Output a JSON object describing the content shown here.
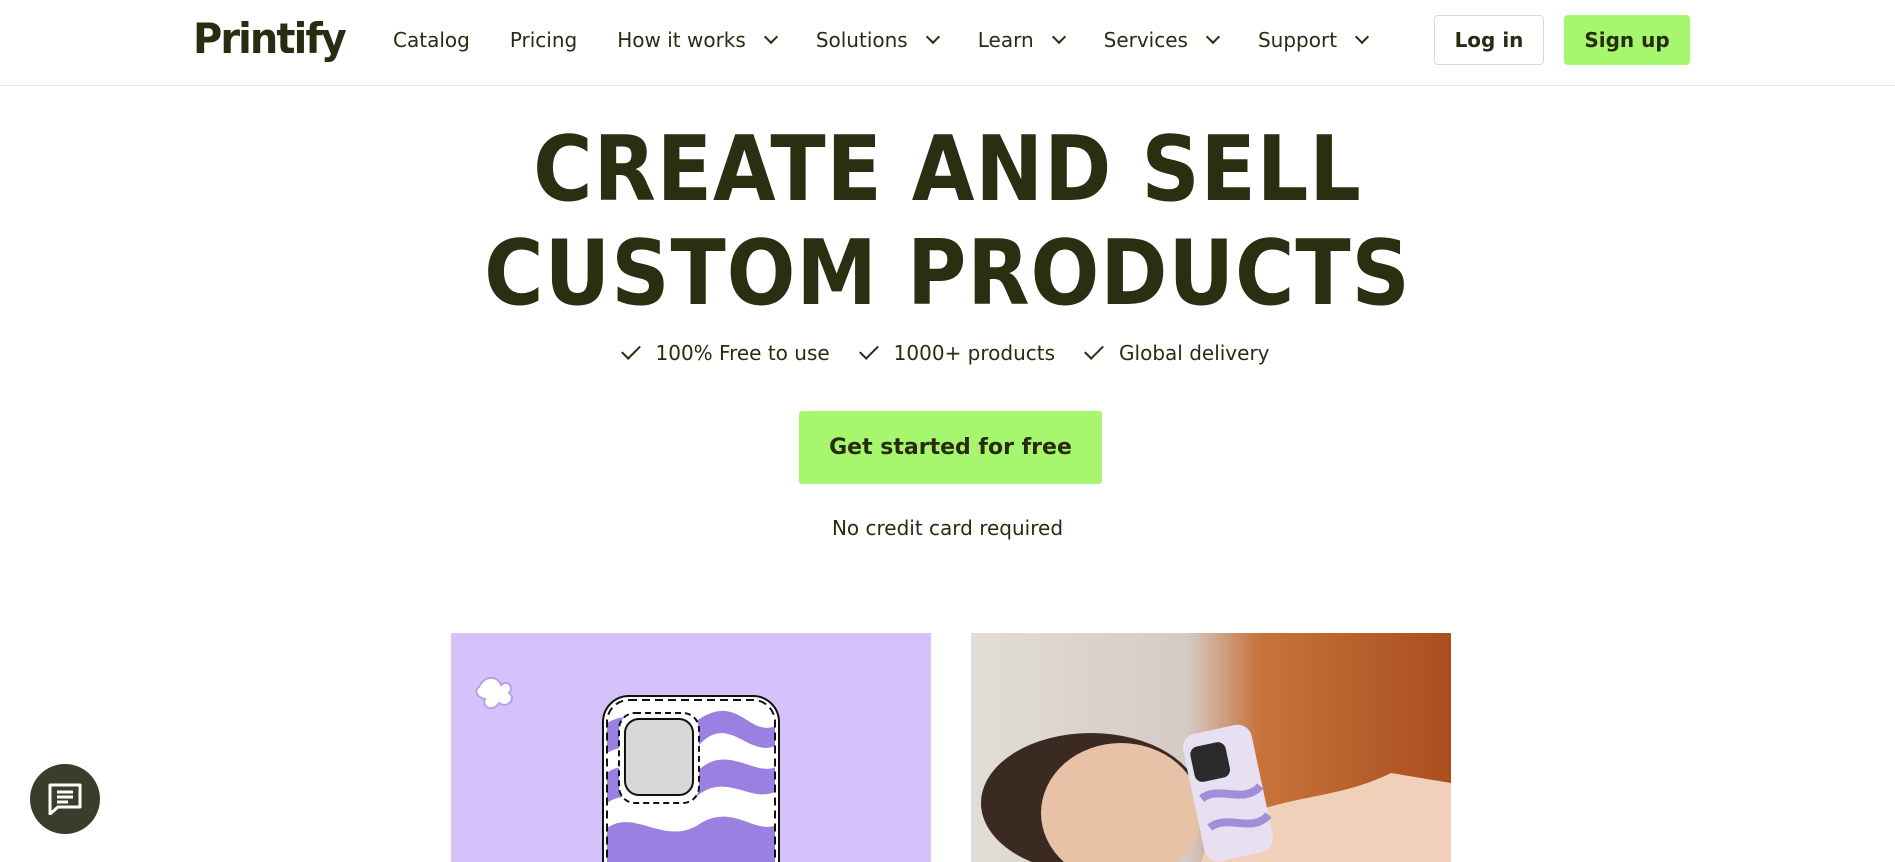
{
  "header": {
    "logo": "Printify",
    "nav": [
      {
        "label": "Catalog",
        "has_dropdown": false
      },
      {
        "label": "Pricing",
        "has_dropdown": false
      },
      {
        "label": "How it works",
        "has_dropdown": true
      },
      {
        "label": "Solutions",
        "has_dropdown": true
      },
      {
        "label": "Learn",
        "has_dropdown": true
      },
      {
        "label": "Services",
        "has_dropdown": true
      },
      {
        "label": "Support",
        "has_dropdown": true
      }
    ],
    "login_label": "Log in",
    "signup_label": "Sign up"
  },
  "hero": {
    "title_line1": "CREATE AND SELL",
    "title_line2": "CUSTOM PRODUCTS",
    "perks": [
      "100% Free to use",
      "1000+ products",
      "Global delivery"
    ],
    "cta_label": "Get started for free",
    "note": "No credit card required"
  },
  "colors": {
    "accent": "#a6f66e",
    "text": "#282c11",
    "lavender": "#d6c2fb",
    "swirl_purple": "#9a80e0"
  },
  "icons": {
    "chevron": "chevron-down-icon",
    "check": "check-icon",
    "chat": "chat-icon"
  }
}
